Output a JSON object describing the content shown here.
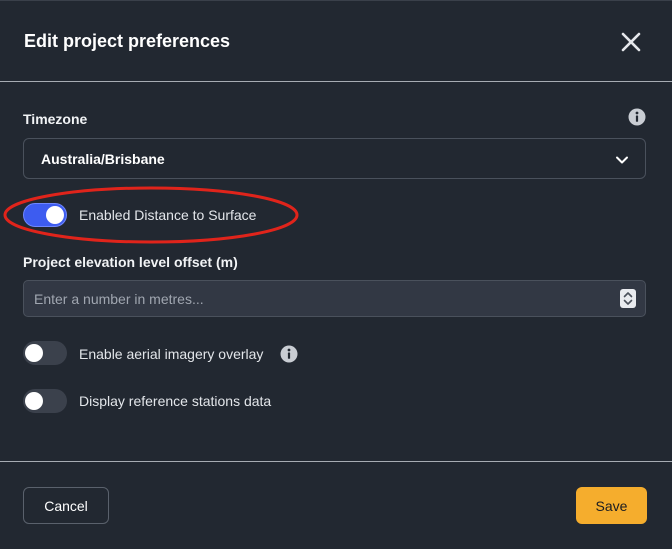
{
  "dialog": {
    "title": "Edit project preferences"
  },
  "timezone": {
    "label": "Timezone",
    "selected": "Australia/Brisbane"
  },
  "toggles": [
    {
      "label": "Enabled Distance to Surface",
      "on": true
    },
    {
      "label": "Enable aerial imagery overlay",
      "on": false
    },
    {
      "label": "Display reference stations data",
      "on": false
    }
  ],
  "elevation": {
    "label": "Project elevation level offset (m)",
    "placeholder": "Enter a number in metres...",
    "value": ""
  },
  "footer": {
    "cancel_label": "Cancel",
    "save_label": "Save"
  },
  "icons": {
    "close": "close-icon",
    "info": "info-icon",
    "chevron": "chevron-down-icon",
    "stepper": "stepper-icon"
  },
  "colors": {
    "background": "#222831",
    "accent_toggle": "#3d5cf0",
    "save_button": "#f5ad2d",
    "highlight_annotation": "#e0241b"
  }
}
